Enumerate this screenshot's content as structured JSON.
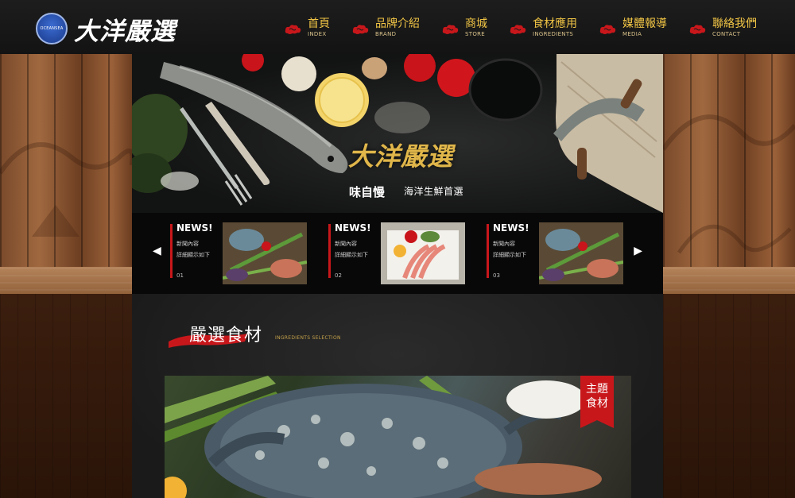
{
  "brand": {
    "badge_text": "OCEANSEA",
    "wordmark": "大洋嚴選",
    "hero_logo": "大洋嚴選",
    "tagline_a": "味自慢",
    "tagline_b": "海洋生鮮首選"
  },
  "nav": {
    "items": [
      {
        "zh": "首頁",
        "en": "INDEX"
      },
      {
        "zh": "品牌介紹",
        "en": "BRAND"
      },
      {
        "zh": "商城",
        "en": "STORE"
      },
      {
        "zh": "食材應用",
        "en": "INGREDIENTS"
      },
      {
        "zh": "媒體報導",
        "en": "MEDIA"
      },
      {
        "zh": "聯絡我們",
        "en": "CONTACT"
      }
    ],
    "cloud_icon": "cloud-icon"
  },
  "news": {
    "prev_arrow": "◀",
    "next_arrow": "▶",
    "cards": [
      {
        "title": "NEWS!",
        "line1": "新聞內容",
        "line2": "詳細顯示如下",
        "number": "01"
      },
      {
        "title": "NEWS!",
        "line1": "新聞內容",
        "line2": "詳細顯示如下",
        "number": "02"
      },
      {
        "title": "NEWS!",
        "line1": "新聞內容",
        "line2": "詳細顯示如下",
        "number": "03"
      }
    ]
  },
  "section": {
    "title": "嚴選食材",
    "subtitle": "INGREDIENTS SELECTION",
    "ribbon_line1": "主題",
    "ribbon_line2": "食材"
  },
  "colors": {
    "accent_red": "#c8171b",
    "nav_gold": "#f0c445",
    "header_bg": "#161616"
  }
}
